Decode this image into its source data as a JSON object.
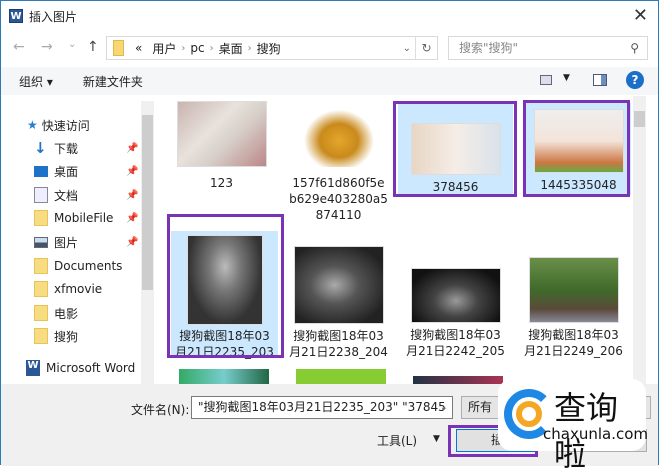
{
  "window": {
    "title": "插入图片",
    "app_icon": "word-icon",
    "close": "✕"
  },
  "nav": {
    "back": "←",
    "forward": "→",
    "recent": "⌄",
    "up": "↑",
    "breadcrumb": [
      "«",
      "用户",
      "pc",
      "桌面",
      "搜狗"
    ],
    "search_placeholder": "搜索\"搜狗\""
  },
  "toolbar": {
    "organize": "组织 ▾",
    "new_folder": "新建文件夹",
    "help": "?"
  },
  "sidebar": {
    "items": [
      {
        "label": "快速访问",
        "icon": "star-icon"
      },
      {
        "label": "下载",
        "icon": "download-icon",
        "pinned": true
      },
      {
        "label": "桌面",
        "icon": "desktop-icon",
        "pinned": true
      },
      {
        "label": "文档",
        "icon": "document-icon",
        "pinned": true
      },
      {
        "label": "MobileFile",
        "icon": "folder-icon",
        "pinned": true
      },
      {
        "label": "图片",
        "icon": "pictures-icon",
        "pinned": true
      },
      {
        "label": "Documents",
        "icon": "folder-icon"
      },
      {
        "label": "xfmovie",
        "icon": "folder-icon"
      },
      {
        "label": "电影",
        "icon": "folder-icon"
      },
      {
        "label": "搜狗",
        "icon": "folder-icon"
      },
      {
        "label": "Microsoft Word",
        "icon": "word-icon"
      }
    ]
  },
  "files": [
    {
      "name": "123",
      "selected": false
    },
    {
      "name": "157f61d860f5e\nb629e403280a5\n874110",
      "selected": false
    },
    {
      "name": "378456",
      "selected": true
    },
    {
      "name": "1445335048",
      "selected": true
    },
    {
      "name": "搜狗截图18年03\n月21日2235_203",
      "selected": true
    },
    {
      "name": "搜狗截图18年03\n月21日2238_204",
      "selected": false
    },
    {
      "name": "搜狗截图18年03\n月21日2242_205",
      "selected": false
    },
    {
      "name": "搜狗截图18年03\n月21日2249_206",
      "selected": false
    }
  ],
  "bottom": {
    "filename_label": "文件名(N):",
    "filename_value": "\"搜狗截图18年03月21日2235_203\" \"37845",
    "filetype": "所有",
    "tools": "工具(L)",
    "insert": "插",
    "cancel": ""
  },
  "watermark": {
    "cn": "查询啦",
    "en": "chaxunla.com"
  },
  "colors": {
    "highlight": "#7a33b5",
    "selection": "#cce8ff",
    "accent": "#0078d7"
  }
}
